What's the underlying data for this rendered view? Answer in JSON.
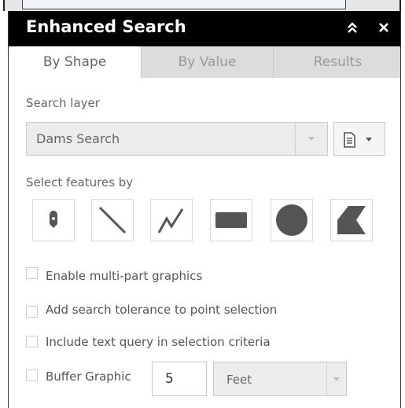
{
  "panel": {
    "title": "Enhanced Search",
    "collapse_icon": "double-chevron-up-icon",
    "close_icon": "close-icon"
  },
  "tabs": [
    {
      "label": "By Shape",
      "active": true
    },
    {
      "label": "By Value",
      "active": false
    },
    {
      "label": "Results",
      "active": false
    }
  ],
  "search_layer": {
    "label": "Search layer",
    "selected": "Dams Search"
  },
  "select_features": {
    "label": "Select features by",
    "tools": [
      "point-icon",
      "line-icon",
      "polyline-icon",
      "rectangle-icon",
      "circle-icon",
      "polygon-icon"
    ]
  },
  "options": [
    {
      "label": "Enable multi-part graphics",
      "checked": false
    },
    {
      "label": "Add search tolerance to point selection",
      "checked": false
    },
    {
      "label": "Include text query in selection criteria",
      "checked": false
    }
  ],
  "buffer": {
    "label": "Buffer Graphic",
    "checked": false,
    "distance": "5",
    "unit": "Feet"
  },
  "colors": {
    "titlebar": "#000000",
    "tab_inactive": "#dcdcdc",
    "icon": "#555555"
  }
}
